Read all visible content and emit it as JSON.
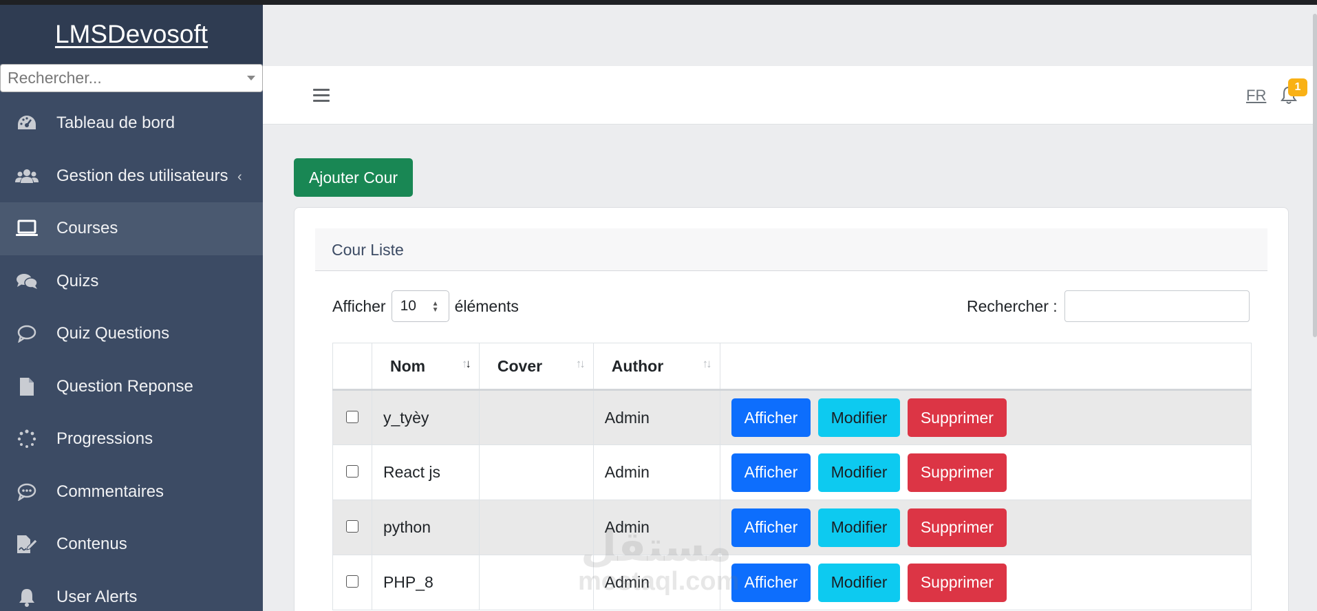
{
  "app": {
    "brand": "LMSDevosoft"
  },
  "sidebar": {
    "search_placeholder": "Rechercher...",
    "items": [
      {
        "label": "Tableau de bord",
        "icon": "dashboard-icon",
        "active": false
      },
      {
        "label": "Gestion des utilisateurs",
        "icon": "users-icon",
        "active": false,
        "has_submenu": true
      },
      {
        "label": "Courses",
        "icon": "laptop-icon",
        "active": true
      },
      {
        "label": "Quizs",
        "icon": "comments-icon",
        "active": false
      },
      {
        "label": "Quiz Questions",
        "icon": "comment-icon",
        "active": false
      },
      {
        "label": "Question Reponse",
        "icon": "file-icon",
        "active": false
      },
      {
        "label": "Progressions",
        "icon": "spinner-icon",
        "active": false
      },
      {
        "label": "Commentaires",
        "icon": "comment-dots-icon",
        "active": false
      },
      {
        "label": "Contenus",
        "icon": "file-signature-icon",
        "active": false
      },
      {
        "label": "User Alerts",
        "icon": "bell-icon",
        "active": false
      }
    ]
  },
  "header": {
    "language": "FR",
    "notification_count": "1"
  },
  "content": {
    "add_button": "Ajouter Cour",
    "card_title": "Cour Liste",
    "length_prefix": "Afficher",
    "length_value": "10",
    "length_suffix": "éléments",
    "search_label": "Rechercher :",
    "columns": [
      "",
      "Nom",
      "Cover",
      "Author",
      ""
    ],
    "rows": [
      {
        "nom": "y_tyèy",
        "cover": "",
        "author": "Admin"
      },
      {
        "nom": "React js",
        "cover": "",
        "author": "Admin"
      },
      {
        "nom": "python",
        "cover": "",
        "author": "Admin"
      },
      {
        "nom": "PHP_8",
        "cover": "",
        "author": "Admin"
      }
    ],
    "actions": {
      "show": "Afficher",
      "edit": "Modifier",
      "delete": "Supprimer"
    }
  },
  "watermark": {
    "arabic": "مستقل",
    "latin": "mostaql.com"
  },
  "colors": {
    "sidebar_bg": "#3c4b64",
    "sidebar_brand_bg": "#2f3c52",
    "success": "#198754",
    "primary": "#0d6efd",
    "info": "#0dcaf0",
    "danger": "#dc3545",
    "warning": "#f9b115"
  }
}
